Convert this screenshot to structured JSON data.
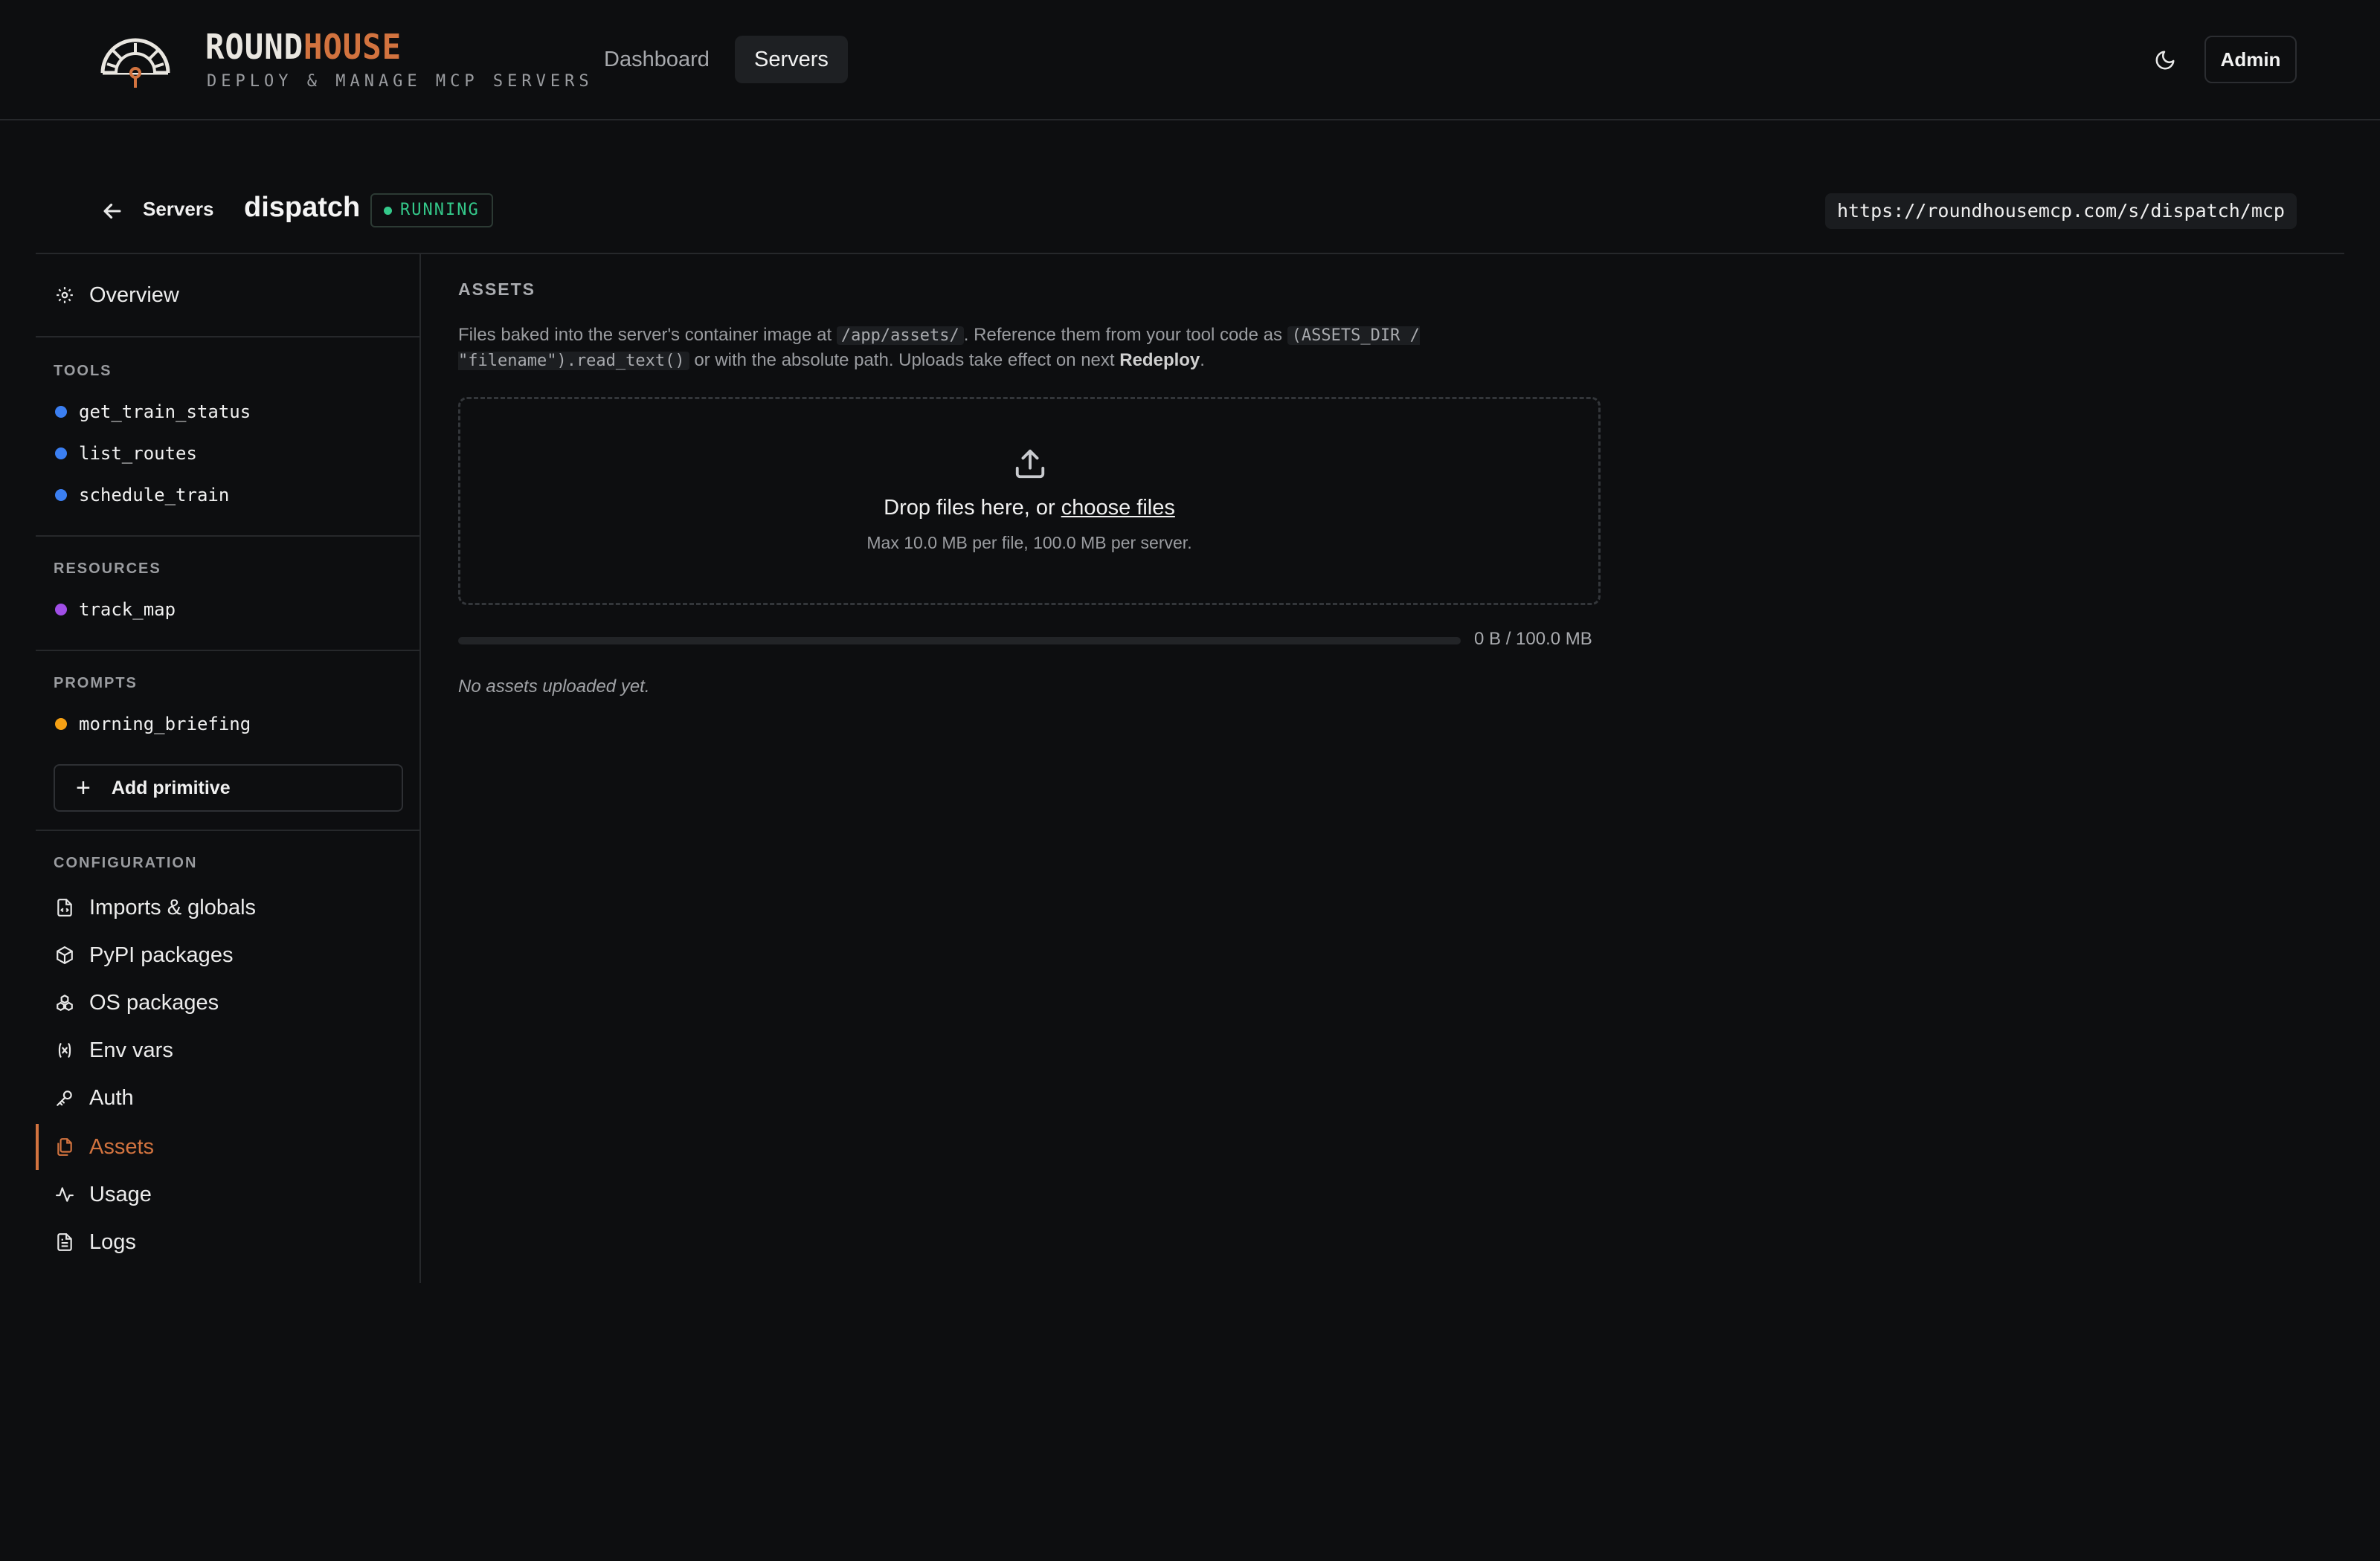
{
  "brand": {
    "part1": "ROUND",
    "part2": "HOUSE",
    "tagline": "DEPLOY & MANAGE MCP SERVERS"
  },
  "topnav": {
    "dashboard": "Dashboard",
    "servers": "Servers",
    "admin": "Admin"
  },
  "header": {
    "breadcrumb": "Servers",
    "server_name": "dispatch",
    "status": "RUNNING",
    "endpoint": "https://roundhousemcp.com/s/dispatch/mcp"
  },
  "sidebar": {
    "overview": "Overview",
    "tools_label": "TOOLS",
    "tools": [
      "get_train_status",
      "list_routes",
      "schedule_train"
    ],
    "resources_label": "RESOURCES",
    "resources": [
      "track_map"
    ],
    "prompts_label": "PROMPTS",
    "prompts": [
      "morning_briefing"
    ],
    "add_primitive": "Add primitive",
    "configuration_label": "CONFIGURATION",
    "config_items": [
      "Imports & globals",
      "PyPI packages",
      "OS packages",
      "Env vars",
      "Auth",
      "Assets",
      "Usage",
      "Logs"
    ],
    "active_item": "Assets"
  },
  "main": {
    "title": "ASSETS",
    "desc_1": "Files baked into the server's container image at",
    "desc_code_1": "/app/assets/",
    "desc_2": ". Reference them from your tool code as",
    "desc_code_2": "(ASSETS_DIR / \"filename\").read_text()",
    "desc_3": "or with the absolute path. Uploads take effect on next",
    "desc_strong": "Redeploy",
    "desc_4": ".",
    "drop_text": "Drop files here, or",
    "choose_files": "choose files",
    "drop_limits": "Max 10.0 MB per file, 100.0 MB per server.",
    "quota_text": "0 B / 100.0 MB",
    "quota_fraction": 0,
    "empty_note": "No assets uploaded yet."
  },
  "colors": {
    "accent": "#d2733f",
    "status_running": "#34c88a",
    "tool_dot": "#3b7ff2",
    "resource_dot": "#a04ee6",
    "prompt_dot": "#f5a014"
  }
}
